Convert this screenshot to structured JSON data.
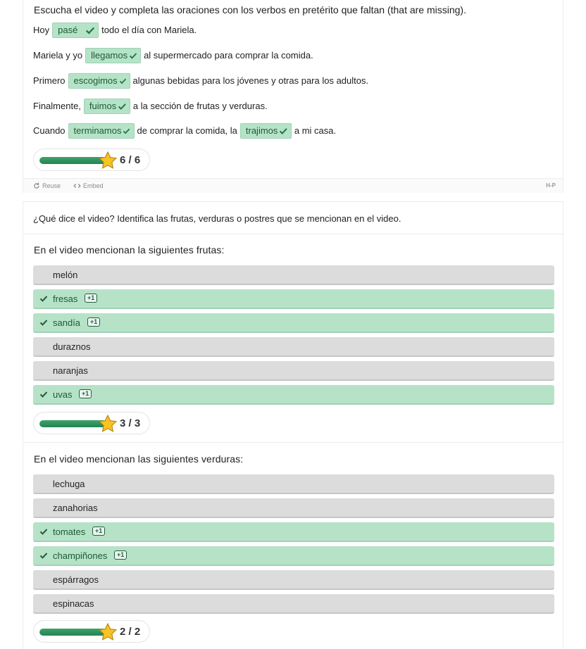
{
  "section1": {
    "instructions": "Escucha el video y completa las oraciones con los verbos en pretérito que faltan (that are missing).",
    "sentences": [
      {
        "before": "Hoy",
        "answer": "pasé",
        "after": "todo el día con Mariela."
      },
      {
        "before": "Mariela y yo",
        "answer": "llegamos",
        "after": "al supermercado para comprar la comida."
      },
      {
        "before": "Primero",
        "answer": "escogimos",
        "after": "algunas bebidas para los jóvenes y otras para los adultos."
      },
      {
        "before": "Finalmente,",
        "answer": "fuimos",
        "after": "a la sección de frutas y verduras."
      },
      {
        "before": "Cuando",
        "answer": "terminamos",
        "middle": "de comprar la comida, la",
        "answer2": "trajimos",
        "after": "a mi casa."
      }
    ],
    "score": {
      "text": "6 / 6",
      "fraction": 1.0
    },
    "footer": {
      "reuse": "Reuse",
      "embed": "Embed",
      "brand": "H-P"
    }
  },
  "section2": {
    "intro": "¿Qué dice el video? Identifica las frutas, verduras o postres que se mencionan en el video.",
    "fruits": {
      "title": "En el video mencionan la siguientes frutas:",
      "items": [
        {
          "label": "melón",
          "correct": false
        },
        {
          "label": "fresas",
          "correct": true,
          "badge": "+1"
        },
        {
          "label": "sandía",
          "correct": true,
          "badge": "+1"
        },
        {
          "label": "duraznos",
          "correct": false
        },
        {
          "label": "naranjas",
          "correct": false
        },
        {
          "label": "uvas",
          "correct": true,
          "badge": "+1"
        }
      ],
      "score": {
        "text": "3 / 3",
        "fraction": 1.0
      }
    },
    "vegetables": {
      "title": "En el video mencionan las siguientes verduras:",
      "items": [
        {
          "label": "lechuga",
          "correct": false
        },
        {
          "label": "zanahorias",
          "correct": false
        },
        {
          "label": "tomates",
          "correct": true,
          "badge": "+1"
        },
        {
          "label": "champiñones",
          "correct": true,
          "badge": "+1"
        },
        {
          "label": "espárragos",
          "correct": false
        },
        {
          "label": "espinacas",
          "correct": false
        }
      ],
      "score": {
        "text": "2 / 2",
        "fraction": 1.0
      }
    }
  },
  "colors": {
    "correct_bg": "#b6e3c8",
    "neutral_bg": "#dcdcdc",
    "progress": "#2f9461",
    "star": "#f7c325"
  }
}
